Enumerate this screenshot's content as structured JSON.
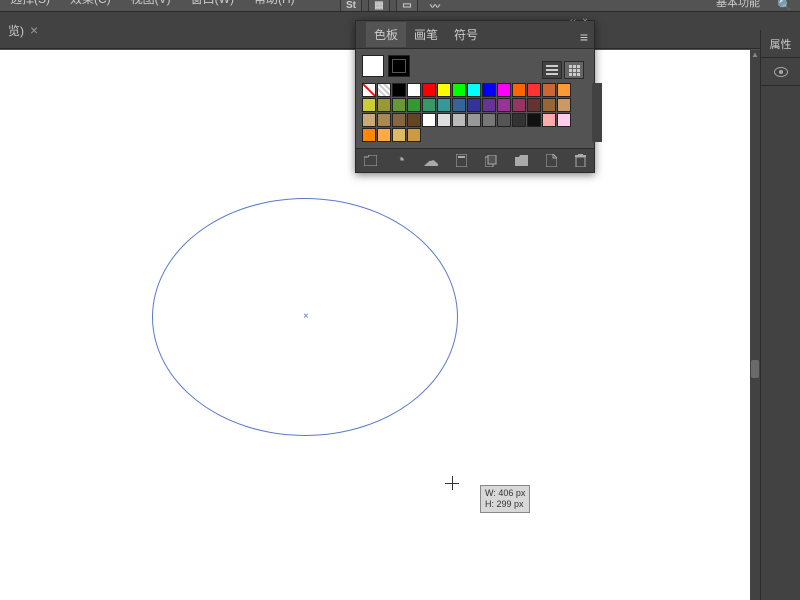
{
  "menu": {
    "items": [
      "选择(S)",
      "效果(C)",
      "视图(V)",
      "窗口(W)",
      "帮助(H)"
    ],
    "right_label": "基本功能"
  },
  "toolbar": {
    "icons": [
      "St",
      "grid",
      "bridge",
      "curve"
    ]
  },
  "tab": {
    "label": "览)",
    "close": "×"
  },
  "canvas": {
    "tooltip": {
      "w": "W: 406 px",
      "h": "H: 299 px"
    }
  },
  "swatch_panel": {
    "tabs": [
      "色板",
      "画笔",
      "符号"
    ],
    "active_tab": 0,
    "controls": {
      "collapse": "‹‹",
      "close": "×"
    },
    "colors_row1": [
      "#ffffff",
      "#ffffff",
      "#000000",
      "#ffffff",
      "#ff0000",
      "#ffff00",
      "#00ff00",
      "#00ffff",
      "#0000ff",
      "#ff00ff",
      "#ff6600",
      "#ff3333",
      "#cc6633",
      "#ff9933"
    ],
    "colors_row2": [
      "#cccc33",
      "#999933",
      "#669933",
      "#339933",
      "#339966",
      "#339999",
      "#336699",
      "#333399",
      "#663399",
      "#993399",
      "#993366",
      "#663333",
      "#996633",
      "#cc9966"
    ],
    "colors_row3": [
      "#ccaa77",
      "#aa8855",
      "#886644",
      "#664422",
      "#ffffff",
      "#dddddd",
      "#bbbbbb",
      "#999999",
      "#777777",
      "#555555",
      "#333333",
      "#111111",
      "#ffaaaa",
      "#ffccee"
    ],
    "colors_row4": [
      "#ff8800",
      "#ffaa44",
      "#ddbb66",
      "#cc9944"
    ]
  },
  "right_sidebar": {
    "header": "属性"
  }
}
